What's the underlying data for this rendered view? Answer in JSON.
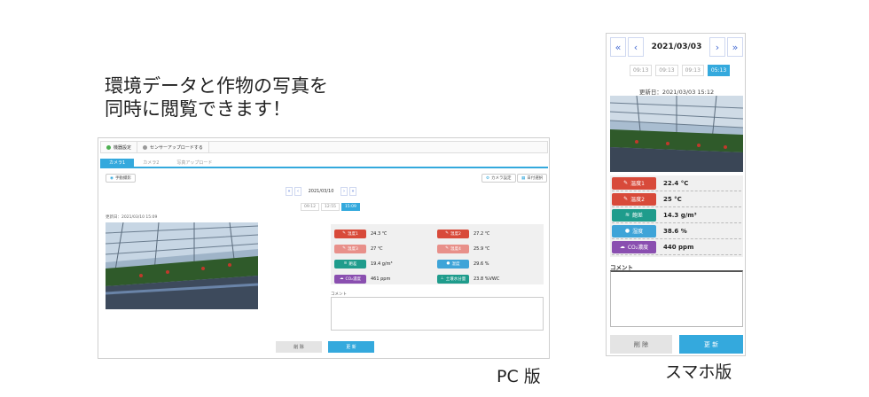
{
  "headline": {
    "line1": "環境データと作物の写真を",
    "line2": "同時に閲覧できます！"
  },
  "captions": {
    "pc": "PC 版",
    "sp": "スマホ版"
  },
  "colors": {
    "accent": "#34a9dd",
    "temp_red": "#d84a3a",
    "temp_pink": "#e8908a",
    "humidity_teal": "#1f9c8c",
    "moisture_blue": "#3ea4d8",
    "co2_purple": "#8a4fb0"
  },
  "pc": {
    "topbar": [
      {
        "icon": "settings-icon",
        "label": "機器設定"
      },
      {
        "icon": "upload-icon",
        "label": "センサーアップロードする"
      }
    ],
    "tabs": [
      {
        "label": "カメラ1",
        "active": true
      },
      {
        "label": "カメラ2",
        "active": false
      },
      {
        "label": "写真アップロード",
        "active": false
      }
    ],
    "manual_shot": "手動撮影",
    "camera_settings": "カメラ設定",
    "date_settings": "日付選択",
    "date": "2021/03/10",
    "times": [
      {
        "label": "09:12",
        "active": false
      },
      {
        "label": "12:55",
        "active": false
      },
      {
        "label": "15:09",
        "active": true
      }
    ],
    "updated": "更新日：2021/03/10 15:09",
    "sensors": [
      {
        "label": "温度1",
        "value": "24.3 ℃",
        "color": "#d84a3a",
        "icon": "thermometer-icon"
      },
      {
        "label": "温度2",
        "value": "27.2 ℃",
        "color": "#d84a3a",
        "icon": "thermometer-icon"
      },
      {
        "label": "温度3",
        "value": "27 ℃",
        "color": "#e8908a",
        "icon": "thermometer-icon"
      },
      {
        "label": "温度4",
        "value": "25.9 ℃",
        "color": "#e8908a",
        "icon": "thermometer-icon"
      },
      {
        "label": "飽差",
        "value": "19.4 g/m³",
        "color": "#1f9c8c",
        "icon": "humidity-icon"
      },
      {
        "label": "湿度",
        "value": "29.6 %",
        "color": "#3ea4d8",
        "icon": "droplet-icon"
      },
      {
        "label": "CO₂濃度",
        "value": "461 ppm",
        "color": "#8a4fb0",
        "icon": "co2-icon"
      },
      {
        "label": "土壌水分量",
        "value": "23.8 %VWC",
        "color": "#1f9c8c",
        "icon": "soil-icon"
      }
    ],
    "comment_label": "コメント",
    "delete": "削 除",
    "update": "更 新"
  },
  "sp": {
    "date": "2021/03/03",
    "times": [
      {
        "label": "09:13",
        "active": false
      },
      {
        "label": "09:13",
        "active": false
      },
      {
        "label": "09:13",
        "active": false
      },
      {
        "label": "05:13",
        "active": true
      }
    ],
    "updated": "更新日：2021/03/03 15:12",
    "sensors": [
      {
        "label": "温度1",
        "value": "22.4 °C",
        "color": "#d84a3a",
        "icon": "thermometer-icon"
      },
      {
        "label": "温度2",
        "value": "25 °C",
        "color": "#d84a3a",
        "icon": "thermometer-icon"
      },
      {
        "label": "飽差",
        "value": "14.3 g/m³",
        "color": "#1f9c8c",
        "icon": "humidity-icon"
      },
      {
        "label": "湿度",
        "value": "38.6 %",
        "color": "#3ea4d8",
        "icon": "droplet-icon"
      },
      {
        "label": "CO₂濃度",
        "value": "440 ppm",
        "color": "#8a4fb0",
        "icon": "co2-icon"
      }
    ],
    "comment_label": "コメント",
    "delete": "削 除",
    "update": "更 新"
  }
}
